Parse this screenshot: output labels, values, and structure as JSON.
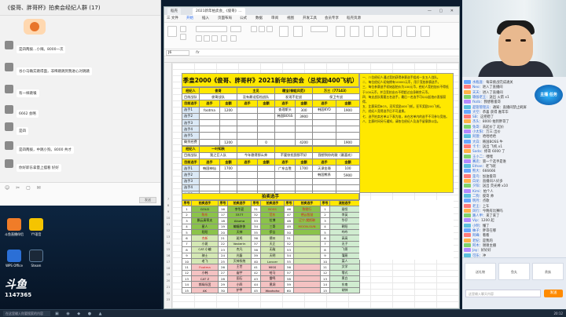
{
  "chat": {
    "title": "《俊哥、胖哥杯》拍卖会经纪人群 (17)",
    "messages": [
      {
        "name": "",
        "text": "是四两拨…小辣。8000一次"
      },
      {
        "name": "",
        "text": "谷小马确实跳得面，非稀跳跳到我进心对跳跳"
      },
      {
        "name": "",
        "text": "有一样跳嗓"
      },
      {
        "name": "",
        "text": "6662 会略"
      },
      {
        "name": "",
        "text": "是四"
      },
      {
        "name": "",
        "text": "是四两拨，中跳小狗。8000 共才"
      },
      {
        "name": "",
        "text": "你好即东拿量上摆看 好好"
      }
    ],
    "send_label": "发送"
  },
  "desktop": {
    "icons": [
      {
        "label": "斗鱼直播伴侣"
      },
      {
        "label": "YY语音"
      },
      {
        "label": "WPS Office"
      },
      {
        "label": "Steam"
      }
    ],
    "logo_text": "斗鱼",
    "room_number": "1147365"
  },
  "taskbar": {
    "search_placeholder": "在这里输入你要搜索的内容",
    "time": "20:12"
  },
  "excel": {
    "tabs": [
      "稻壳",
      "2021新年拍卖会_《俊哥》…"
    ],
    "menus": [
      "三 文件",
      "开始",
      "插入",
      "页面布局",
      "公式",
      "数据",
      "审阅",
      "视图",
      "开发工具",
      "会员专享",
      "稻壳资源"
    ],
    "selected_menu": "开始",
    "cell_ref": "J6",
    "fx": "fx",
    "row_numbers": [
      "7",
      "8",
      "9",
      "10",
      "11",
      "12",
      "13",
      "14",
      "15",
      "16",
      "17",
      "18",
      "19",
      "20",
      "21",
      "22",
      "23",
      "24",
      "25",
      "26",
      "27",
      "28",
      "29",
      "30",
      "31",
      "32",
      "33",
      "34",
      "35",
      "36",
      "37",
      "38",
      "39",
      "40"
    ],
    "auction_title": "季皇2000《俊哥、胖哥杯》2021新年拍卖会（总奖励400飞机）",
    "team_block_1": {
      "headers": [
        "经纪人",
        "俊哥",
        "主见",
        "",
        "穗宝(御姐风范)",
        "",
        "万三（77143）",
        ""
      ],
      "sub": [
        "目前战队",
        "俊哥战队",
        "",
        "没有最适搭档战队",
        "",
        "发现不定战",
        "",
        "保卫专战"
      ],
      "cols": [
        "目前选手",
        "选手",
        "金额",
        "选手",
        "金额",
        "选手",
        "金额",
        "选手"
      ],
      "rows": [
        [
          "选手1",
          "footma",
          "1200",
          "",
          "",
          "查理斯头",
          "300",
          "韩国KYO",
          "1900"
        ],
        [
          "选手2",
          "",
          "",
          "",
          "",
          "韩国BOSS",
          "3900",
          "",
          ""
        ],
        [
          "选手3",
          "",
          "",
          "",
          "",
          "",
          "",
          "",
          ""
        ],
        [
          "选手4",
          "",
          "",
          "",
          "",
          "",
          "",
          "",
          ""
        ],
        [
          "选手5",
          "",
          "",
          "",
          "",
          "",
          "",
          "",
          ""
        ]
      ],
      "total": [
        "剩余经费",
        "",
        "1200",
        "",
        "0",
        "",
        "4200",
        "",
        "1900"
      ]
    },
    "team_block_2": {
      "headers": [
        "经纪人",
        "一叶知秋",
        "",
        "技术哥（元老战团）",
        "",
        "雷哥",
        "",
        "修哥"
      ],
      "sub": [
        "目前战队",
        "我之巨人队",
        "",
        "今年稳得那么帅",
        "",
        "不要惊扰我那不好",
        "",
        "我想到你的歌（最喜欢）"
      ],
      "cols": [
        "目前选手",
        "选手",
        "金额",
        "选手",
        "金额",
        "选手",
        "金额",
        "选手"
      ],
      "rows": [
        [
          "选手1",
          "韩国神仙",
          "1700",
          "",
          "",
          "广东吉胜",
          "1700",
          "天津金哥",
          "100"
        ],
        [
          "选手2",
          "",
          "",
          "",
          "",
          "",
          "",
          "韩国熊系",
          "5900"
        ],
        [
          "选手3",
          "",
          "",
          "",
          "",
          "",
          "",
          "",
          ""
        ],
        [
          "选手4",
          "",
          "",
          "",
          "",
          "",
          "",
          "",
          ""
        ],
        [
          "选手5",
          "",
          "",
          "",
          "",
          "",
          "",
          "",
          ""
        ]
      ],
      "total": [
        "剩余经费",
        "",
        "1700",
        "",
        "0",
        "",
        "1700",
        "",
        "6000"
      ]
    },
    "rules": [
      "一、八位经纪人通过竞拍获得参赛选手组成一支五人战队。",
      "二、每位经纪人初始拥有10000元币，用于竞拍参赛选手。",
      "三、每位参赛选手初始起拍价为100元币，经纪人竞拍加价不得低于100元币，并且竞拍出价不得超过自身剩余元币。",
      "四、每支战队需要五名选手，最后一名选手可以以起拍价直接获得。",
      "五、比赛采用BO3，冠军奖励400飞机，亚军奖励200飞机。",
      "六、经纪人竞得选手后不可退换。",
      "七、选手拍卖名单以下表为准，未在名单内的选手不可参与竞拍。",
      "八、比赛时间另行通知，请各位经纪人及选手留意群公告。"
    ],
    "roster_title": "拍卖选手",
    "roster_headers": [
      "序号",
      "拍卖选手",
      "序号",
      "拍卖选手",
      "序号",
      "拍卖选手",
      "序号",
      "拍卖选手",
      "序号",
      "流拍选手"
    ],
    "roster_rows": [
      [
        "1",
        "GOLD",
        "16",
        "李华夏",
        "31",
        "BOSS",
        "46",
        "陈锐行",
        "1",
        "聂恒"
      ],
      [
        "2",
        "陈东",
        "17",
        "3377",
        "32",
        "范东",
        "47",
        "德云智慧",
        "2",
        "李英"
      ],
      [
        "3",
        "飘云真蒂夫",
        "18",
        "Akuma",
        "33",
        "拉博",
        "48",
        "辽宁-樊斯琳",
        "3",
        "华仔"
      ],
      [
        "4",
        "星人",
        "19",
        "蝙蝠侠侠",
        "34",
        "三哥",
        "49",
        "MOON-SUN",
        "4",
        "朝阳"
      ],
      [
        "5",
        "阳阳",
        "20",
        "天神",
        "35",
        "伊吉",
        "50",
        "",
        "5",
        "咋咋"
      ],
      [
        "6",
        "杰新",
        "21",
        "斑鸠",
        "36",
        "德曰",
        "51",
        "",
        "6",
        "高高"
      ],
      [
        "7",
        "小斑",
        "22",
        "Vasterin",
        "37",
        "天正",
        "52",
        "",
        "7",
        "无子"
      ],
      [
        "8",
        "CAT-小编",
        "23",
        "杰凡",
        "38",
        "无敌",
        "53",
        "",
        "8",
        "飞哥"
      ],
      [
        "9",
        "骑士",
        "24",
        "光磊",
        "39",
        "天明",
        "54",
        "",
        "9",
        "蒲燕"
      ],
      [
        "10",
        "老飞",
        "25",
        "灭神系统",
        "40",
        "Lancer",
        "55",
        "",
        "10",
        "菜人"
      ],
      [
        "11",
        "Footma",
        "26",
        "王世",
        "41",
        "MISS",
        "56",
        "",
        "11",
        "文学"
      ],
      [
        "12",
        "小韩",
        "27",
        "庙宇",
        "42",
        "哈马",
        "57",
        "",
        "12",
        "零式"
      ],
      [
        "13",
        "CAT Z",
        "28",
        "田石",
        "43",
        "雷鸣",
        "58",
        "",
        "13",
        "黑白"
      ],
      [
        "14",
        "郎绿乐团",
        "29",
        "小四",
        "44",
        "黑洞",
        "59",
        "",
        "14",
        "东南"
      ],
      [
        "15",
        "AK",
        "30",
        "护甲",
        "45",
        "Woohoho",
        "60",
        "",
        "15",
        "胡帅"
      ]
    ]
  },
  "live": {
    "rows": [
      {
        "user": "水瓶座",
        "text": "每日挑战完成通关"
      },
      {
        "user": "Neo",
        "text": "进入了直播间"
      },
      {
        "user": "天天",
        "text": "进入了直播间"
      },
      {
        "user": "瑜伽老王",
        "text": "送出 火箭 x1"
      },
      {
        "user": "fkslb",
        "text": "我想看俊哥"
      },
      {
        "user": "超管管理员",
        "text": "通知：直播间禁止刷屏"
      },
      {
        "user": "大空",
        "text": "恭喜 获得 嘉年华"
      },
      {
        "user": "SB",
        "text": "这把稳了"
      },
      {
        "user": "杰头",
        "text": "8000 拍到胖哥了"
      },
      {
        "user": "兔哥",
        "text": "去起价了 起价"
      },
      {
        "user": "小太阳",
        "text": "万三 出价"
      },
      {
        "user": "阿狸",
        "text": "哈哈哈哈"
      },
      {
        "user": "大白",
        "text": "韩国BOSS 牛"
      },
      {
        "user": "卡卡",
        "text": "送出 飞机 x1"
      },
      {
        "user": "Soda",
        "text": "修哥 6000 了"
      },
      {
        "user": "王小二",
        "text": "嘿嘿"
      },
      {
        "user": "赛克",
        "text": "第一个选手是谁"
      },
      {
        "user": "Ethan",
        "text": "老飞呢"
      },
      {
        "user": "熊大",
        "text": "666666"
      },
      {
        "user": "菜鸟",
        "text": "加油俊哥"
      },
      {
        "user": "白龙",
        "text": "直播间人好多"
      },
      {
        "user": "夕阳",
        "text": "送出 荧光棒 x10"
      },
      {
        "user": "Kimi",
        "text": "拍个人"
      },
      {
        "user": "二狗",
        "text": "俊哥 帅"
      },
      {
        "user": "明月",
        "text": "点歌"
      },
      {
        "user": "老王",
        "text": "上车"
      },
      {
        "user": "风行",
        "text": "今晚有比赛吗"
      },
      {
        "user": "路人甲",
        "text": "来了来了"
      },
      {
        "user": "Vip",
        "text": "1200 起"
      },
      {
        "user": "小明",
        "text": "懂了"
      },
      {
        "user": "柚子",
        "text": "胖哥在哪"
      },
      {
        "user": "阿峰",
        "text": "看看"
      },
      {
        "user": "老纪",
        "text": "是我的"
      },
      {
        "user": "阿木",
        "text": "谢谢主播"
      },
      {
        "user": "Jay",
        "text": "好好好"
      },
      {
        "user": "可乐",
        "text": "冲"
      }
    ],
    "gift_label": "主播 任务",
    "gift_boxes": [
      "送礼物",
      "鱼丸",
      "贵族"
    ],
    "input_placeholder": "这里输入聊天内容",
    "send_label": "发送"
  }
}
